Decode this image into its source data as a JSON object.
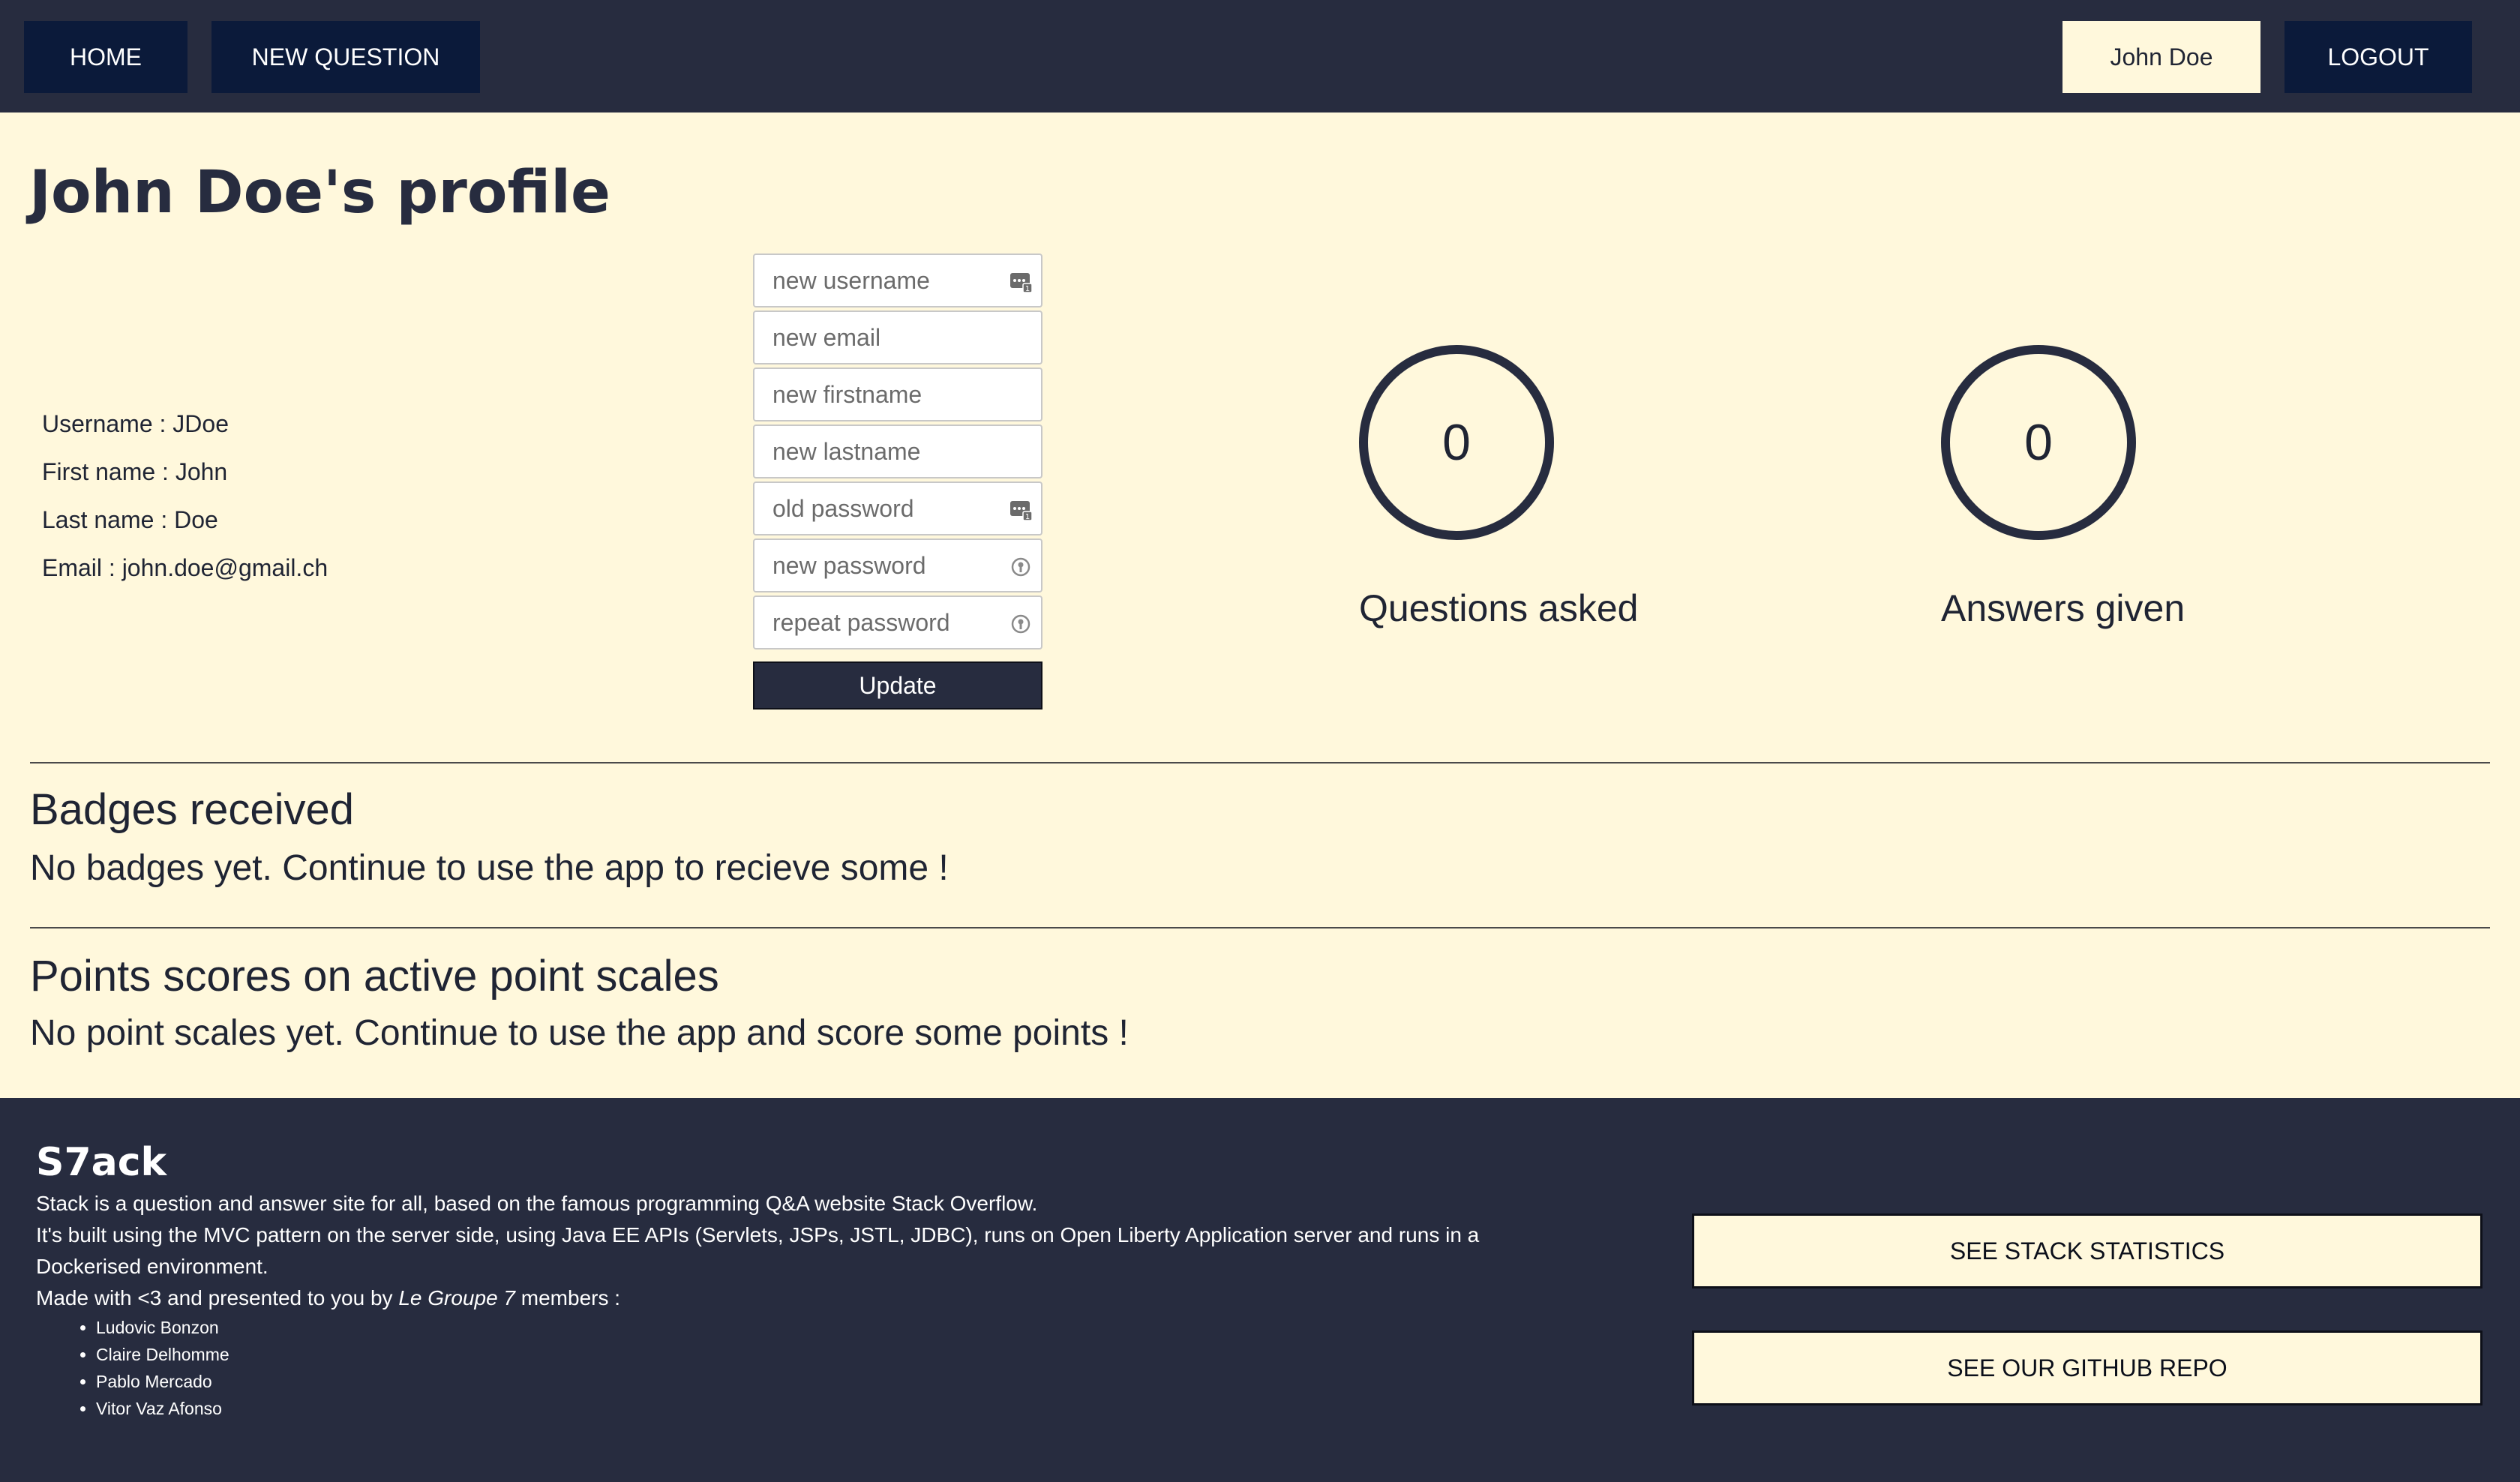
{
  "nav": {
    "home_label": "HOME",
    "new_question_label": "NEW QUESTION",
    "user_label": "John Doe",
    "logout_label": "LOGOUT"
  },
  "profile": {
    "title": "John Doe's profile",
    "info": {
      "username": "Username : JDoe",
      "firstname": "First name : John",
      "lastname": "Last name : Doe",
      "email": "Email : john.doe@gmail.ch"
    }
  },
  "form": {
    "username_placeholder": "new username",
    "email_placeholder": "new email",
    "firstname_placeholder": "new firstname",
    "lastname_placeholder": "new lastname",
    "old_password_placeholder": "old password",
    "new_password_placeholder": "new password",
    "repeat_password_placeholder": "repeat password",
    "update_label": "Update"
  },
  "stats": {
    "questions_count": "0",
    "questions_label": "Questions asked",
    "answers_count": "0",
    "answers_label": "Answers given"
  },
  "badges": {
    "heading": "Badges received",
    "empty_text": "No badges yet. Continue to use the app to recieve some !"
  },
  "points": {
    "heading": "Points scores on active point scales",
    "empty_text": "No point scales yet. Continue to use the app and score some points !"
  },
  "footer": {
    "brand": "S7ack",
    "line1": "Stack is a question and answer site for all, based on the famous programming Q&A website Stack Overflow.",
    "line2": "It's built using the MVC pattern on the server side, using Java EE APIs (Servlets, JSPs, JSTL, JDBC), runs on Open Liberty Application server and runs in a Dockerised environment.",
    "made_prefix": "Made with <3 and presented to you by ",
    "made_group": "Le Groupe 7",
    "made_suffix": " members :",
    "members": [
      "Ludovic Bonzon",
      "Claire Delhomme",
      "Pablo Mercado",
      "Vitor Vaz Afonso"
    ],
    "stats_button": "SEE STACK STATISTICS",
    "github_button": "SEE OUR GITHUB REPO"
  },
  "colors": {
    "navbar": "#272c3f",
    "nav_button": "#0b1a3a",
    "background": "#fff8dc",
    "dark_text": "#1f2433"
  }
}
